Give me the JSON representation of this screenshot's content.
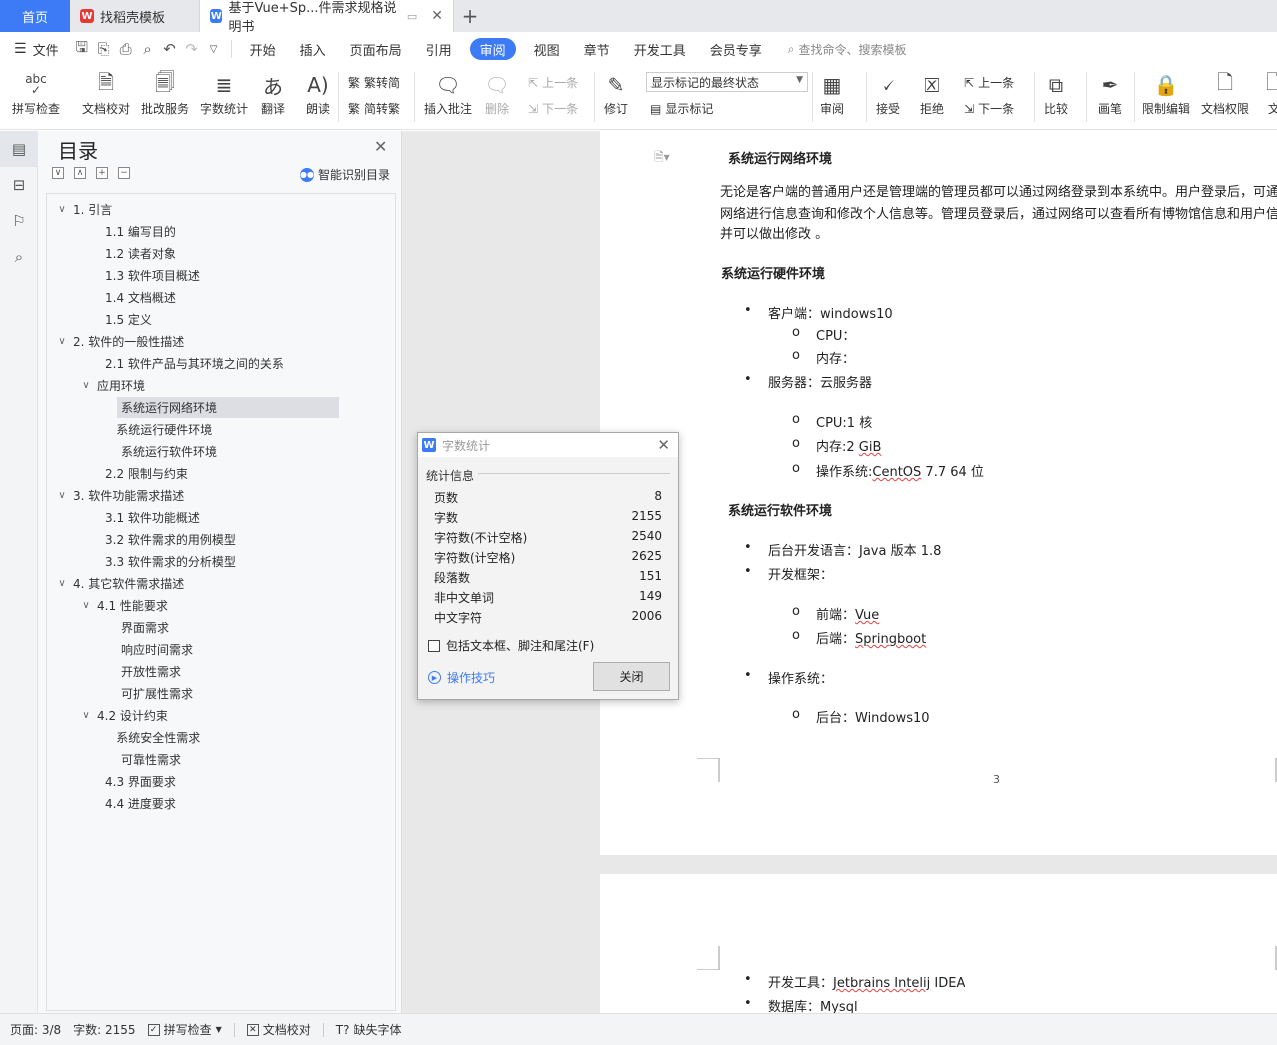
{
  "tabs": {
    "home": "首页",
    "items": [
      {
        "label": "找稻壳模板",
        "active": false,
        "icon_color": "#e53935"
      },
      {
        "label": "基于Vue+Sp...件需求规格说明书",
        "active": true,
        "icon_color": "#3c7bf5"
      }
    ],
    "add": "+"
  },
  "menu": {
    "file": "文件",
    "items": [
      "开始",
      "插入",
      "页面布局",
      "引用",
      "审阅",
      "视图",
      "章节",
      "开发工具",
      "会员专享"
    ],
    "active": "审阅",
    "search": "查找命令、搜索模板"
  },
  "ribbon": {
    "spellcheck": "拼写检查",
    "spellcheck_top": "abc",
    "proofread": "文档校对",
    "review_service": "批改服务",
    "word_count": "字数统计",
    "translate": "翻译",
    "read_aloud": "朗读",
    "to_traditional": "繁转简",
    "to_simplified": "简转繁",
    "insert_comment": "插入批注",
    "delete": "删除",
    "prev": "上一条",
    "next": "下一条",
    "track": "修订",
    "display_state": "显示标记的最终状态",
    "show_markup": "显示标记",
    "review": "审阅",
    "accept": "接受",
    "reject": "拒绝",
    "prev2": "上一条",
    "next2": "下一条",
    "compare": "比较",
    "pen": "画笔",
    "restrict_edit": "限制编辑",
    "doc_permission": "文档权限",
    "doc_cut": "文"
  },
  "toc": {
    "title": "目录",
    "smart": "智能识别目录",
    "items": [
      {
        "label": "1.  引言",
        "caret": "∨",
        "indent": 0
      },
      {
        "label": "1.1  编写目的",
        "caret": "",
        "indent": 2
      },
      {
        "label": "1.2  读者对象",
        "caret": "",
        "indent": 2
      },
      {
        "label": "1.3  软件项目概述",
        "caret": "",
        "indent": 2
      },
      {
        "label": "1.4  文档概述",
        "caret": "",
        "indent": 2
      },
      {
        "label": "1.5  定义",
        "caret": "",
        "indent": 2
      },
      {
        "label": "2.  软件的一般性描述",
        "caret": "∨",
        "indent": 0
      },
      {
        "label": "2.1 软件产品与其环境之间的关系",
        "caret": "",
        "indent": 2
      },
      {
        "label": "应用环境",
        "caret": "∨",
        "indent": 1.5
      },
      {
        "label": "系统运行网络环境",
        "caret": "",
        "indent": 3,
        "selected": true
      },
      {
        "label": "系统运行硬件环境",
        "caret": "",
        "indent": 2.7
      },
      {
        "label": "系统运行软件环境",
        "caret": "",
        "indent": 3
      },
      {
        "label": "2.2 限制与约束",
        "caret": "",
        "indent": 2
      },
      {
        "label": "3.  软件功能需求描述",
        "caret": "∨",
        "indent": 0
      },
      {
        "label": "3.1  软件功能概述",
        "caret": "",
        "indent": 2
      },
      {
        "label": "3.2  软件需求的用例模型",
        "caret": "",
        "indent": 2
      },
      {
        "label": "3.3  软件需求的分析模型",
        "caret": "",
        "indent": 2
      },
      {
        "label": "4.  其它软件需求描述",
        "caret": "∨",
        "indent": 0
      },
      {
        "label": "4.1  性能要求",
        "caret": "∨",
        "indent": 1.5
      },
      {
        "label": "界面需求",
        "caret": "",
        "indent": 3
      },
      {
        "label": "响应时间需求",
        "caret": "",
        "indent": 3
      },
      {
        "label": "开放性需求",
        "caret": "",
        "indent": 3
      },
      {
        "label": "可扩展性需求",
        "caret": "",
        "indent": 3
      },
      {
        "label": "4.2  设计约束",
        "caret": "∨",
        "indent": 1.5
      },
      {
        "label": "系统安全性需求",
        "caret": "",
        "indent": 2.7
      },
      {
        "label": "可靠性需求",
        "caret": "",
        "indent": 3
      },
      {
        "label": "4.3  界面要求",
        "caret": "",
        "indent": 2
      },
      {
        "label": "4.4  进度要求",
        "caret": "",
        "indent": 2
      }
    ]
  },
  "document": {
    "h_network": "系统运行网络环境",
    "p_network_1": "无论是客户端的普通用户还是管理端的管理员都可以通过网络登录到本系统中。用户登录后，可通过",
    "p_network_2": "网络进行信息查询和修改个人信息等。管理员登录后，通过网络可以查看所有博物馆信息和用户信息，",
    "p_network_3": "并可以做出修改 。",
    "h_hardware": "系统运行硬件环境",
    "client": "客户端：windows10",
    "cpu": "CPU：",
    "memory": "内存：",
    "server": "服务器：云服务器",
    "cpu_server": "CPU:1 核",
    "mem_server_prefix": "内存:2 ",
    "mem_server_unit": "GiB",
    "os_server_prefix": "操作系统:",
    "os_server_name": "CentOS",
    "os_server_suffix": " 7.7 64 位",
    "h_software": "系统运行软件环境",
    "backend_lang": "后台开发语言：Java  版本 1.8",
    "framework": "开发框架：",
    "frontend_prefix": "前端：",
    "frontend_name": "Vue",
    "backend_prefix": "后端：",
    "backend_name": "Springboot",
    "os": "操作系统：",
    "os_backend": "后台：Windows10",
    "page_number": "3",
    "dev_tool_prefix": "开发工具：",
    "dev_tool_name": "Jetbrains Intelij",
    "dev_tool_suffix": " IDEA",
    "database_prefix": "数据库：",
    "database_name": "Mysql"
  },
  "dialog": {
    "title": "字数统计",
    "group": "统计信息",
    "rows": [
      {
        "label": "页数",
        "value": "8"
      },
      {
        "label": "字数",
        "value": "2155"
      },
      {
        "label": "字符数(不计空格)",
        "value": "2540"
      },
      {
        "label": "字符数(计空格)",
        "value": "2625"
      },
      {
        "label": "段落数",
        "value": "151"
      },
      {
        "label": "非中文单词",
        "value": "149"
      },
      {
        "label": "中文字符",
        "value": "2006"
      }
    ],
    "checkbox": "包括文本框、脚注和尾注(F)",
    "tips": "操作技巧",
    "close": "关闭"
  },
  "status": {
    "page": "页面: 3/8",
    "words": "字数: 2155",
    "spellcheck": "拼写检查",
    "proofread": "文档校对",
    "missing_font": "缺失字体"
  },
  "colors": {
    "accent": "#3c7bf5",
    "squiggle": "#e04343"
  }
}
